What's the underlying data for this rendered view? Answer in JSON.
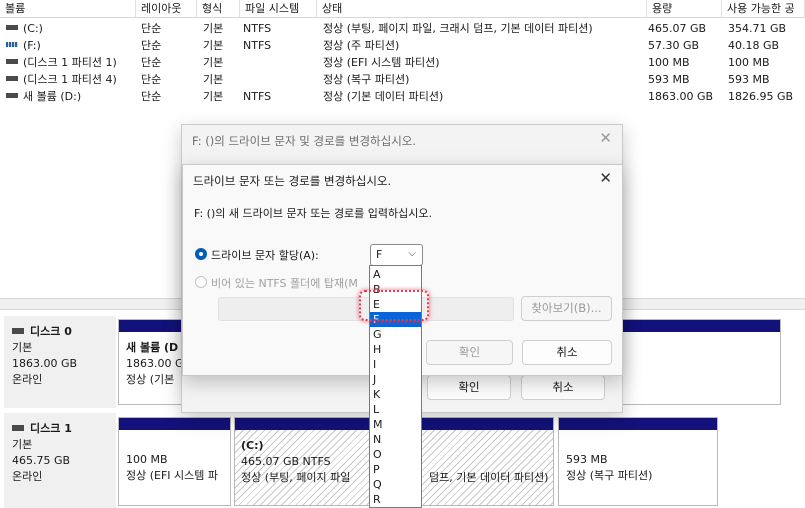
{
  "columns": [
    "볼륨",
    "레이아웃",
    "형식",
    "파일 시스템",
    "상태",
    "용량",
    "사용 가능한 공"
  ],
  "volumes": [
    {
      "name": "(C:)",
      "layout": "단순",
      "type": "기본",
      "fs": "NTFS",
      "status": "정상 (부팅, 페이지 파일, 크래시 덤프, 기본 데이터 파티션)",
      "capacity": "465.07 GB",
      "free": "354.71 GB",
      "icon": "drive-icon"
    },
    {
      "name": "(F:)",
      "layout": "단순",
      "type": "기본",
      "fs": "NTFS",
      "status": "정상 (주 파티션)",
      "capacity": "57.30 GB",
      "free": "40.18 GB",
      "icon": "striped-drive-icon"
    },
    {
      "name": "(디스크 1 파티션 1)",
      "layout": "단순",
      "type": "기본",
      "fs": "",
      "status": "정상 (EFI 시스템 파티션)",
      "capacity": "100 MB",
      "free": "100 MB",
      "icon": "drive-icon"
    },
    {
      "name": "(디스크 1 파티션 4)",
      "layout": "단순",
      "type": "기본",
      "fs": "",
      "status": "정상 (복구 파티션)",
      "capacity": "593 MB",
      "free": "593 MB",
      "icon": "drive-icon"
    },
    {
      "name": "새 볼륨 (D:)",
      "layout": "단순",
      "type": "기본",
      "fs": "NTFS",
      "status": "정상 (기본 데이터 파티션)",
      "capacity": "1863.00 GB",
      "free": "1826.95 GB",
      "icon": "drive-icon"
    }
  ],
  "disks": [
    {
      "name": "디스크 0",
      "type": "기본",
      "size": "1863.00 GB",
      "state": "온라인",
      "partitions": [
        {
          "title": "새 볼륨 (D",
          "size": "1863.00 GB",
          "status": "정상 (기본"
        }
      ]
    },
    {
      "name": "디스크 1",
      "type": "기본",
      "size": "465.75 GB",
      "state": "온라인",
      "partitions": [
        {
          "title": "",
          "size": "100 MB",
          "status": "정상 (EFI 시스템 파"
        },
        {
          "title": "(C:)",
          "size": "465.07 GB NTFS",
          "status": "정상 (부팅, 페이지 파일",
          "status_tail": "덤프, 기본 데이터 파티션)"
        },
        {
          "title": "",
          "size": "593 MB",
          "status": "정상 (복구 파티션)"
        }
      ]
    }
  ],
  "outer_dialog": {
    "title": "F: ()의 드라이브 문자 및 경로를 변경하십시오.",
    "ok": "확인",
    "cancel": "취소"
  },
  "inner_dialog": {
    "title": "드라이브 문자 또는 경로를 변경하십시오.",
    "instruction": "F: ()의 새 드라이브 문자 또는 경로를 입력하십시오.",
    "radio_assign": "드라이브 문자 할당(A):",
    "radio_mount": "비어 있는 NTFS 폴더에 탑재(M",
    "browse": "찾아보기(B)...",
    "ok": "확인",
    "cancel": "취소",
    "selected_letter": "F"
  },
  "letters": [
    "A",
    "B",
    "E",
    "F",
    "G",
    "H",
    "I",
    "J",
    "K",
    "L",
    "M",
    "N",
    "O",
    "P",
    "Q",
    "R"
  ],
  "selected_index": 3,
  "close_glyph": "✕",
  "chevron_glyph": "⌵"
}
